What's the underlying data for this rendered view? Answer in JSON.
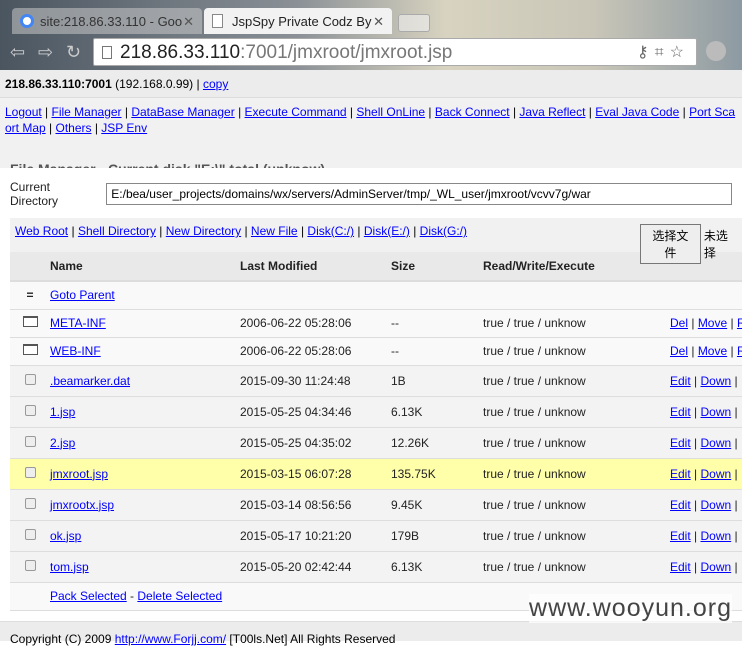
{
  "browser": {
    "tabs": [
      {
        "title": "site:218.86.33.110 - Goo"
      },
      {
        "title": "JspSpy Private Codz By"
      }
    ],
    "url_host": "218.86.33.110",
    "url_rest": ":7001/jmxroot/jmxroot.jsp"
  },
  "info": {
    "host": "218.86.33.110:7001",
    "ip": " (192.168.0.99) | ",
    "copy": "copy"
  },
  "menu": {
    "line1": [
      "Logout",
      "File Manager",
      "DataBase Manager",
      "Execute Command",
      "Shell OnLine",
      "Back Connect",
      "Java Reflect",
      "Eval Java Code",
      "Port Sca"
    ],
    "line2": [
      "ort Map",
      "Others",
      "JSP Env"
    ]
  },
  "title": "File Manager - Current disk \"E:\\\" total (unknow)",
  "current_dir": {
    "label": "Current Directory",
    "value": "E:/bea/user_projects/domains/wx/servers/AdminServer/tmp/_WL_user/jmxroot/vcvv7g/war"
  },
  "shortcuts": [
    "Web Root",
    "Shell Directory",
    "New Directory",
    "New File",
    "Disk(C:/)",
    "Disk(E:/)",
    "Disk(G:/)"
  ],
  "upload": {
    "button": "选择文件",
    "status": "未选择"
  },
  "table": {
    "headers": [
      "Name",
      "Last Modified",
      "Size",
      "Read/Write/Execute"
    ],
    "parent": "Goto Parent",
    "rows": [
      {
        "type": "folder",
        "name": "META-INF",
        "modified": "2006-06-22 05:28:06",
        "size": "--",
        "perm": "true / true / unknow",
        "actions": [
          "Del",
          "Move",
          "R"
        ]
      },
      {
        "type": "folder",
        "name": "WEB-INF",
        "modified": "2006-06-22 05:28:06",
        "size": "--",
        "perm": "true / true / unknow",
        "actions": [
          "Del",
          "Move",
          "R"
        ]
      },
      {
        "type": "file",
        "name": ".beamarker.dat",
        "modified": "2015-09-30 11:24:48",
        "size": "1B",
        "perm": "true / true / unknow",
        "actions": [
          "Edit",
          "Down"
        ]
      },
      {
        "type": "file",
        "name": "1.jsp",
        "modified": "2015-05-25 04:34:46",
        "size": "6.13K",
        "perm": "true / true / unknow",
        "actions": [
          "Edit",
          "Down"
        ]
      },
      {
        "type": "file",
        "name": "2.jsp",
        "modified": "2015-05-25 04:35:02",
        "size": "12.26K",
        "perm": "true / true / unknow",
        "actions": [
          "Edit",
          "Down"
        ]
      },
      {
        "type": "file",
        "name": "jmxroot.jsp",
        "modified": "2015-03-15 06:07:28",
        "size": "135.75K",
        "perm": "true / true / unknow",
        "actions": [
          "Edit",
          "Down"
        ],
        "highlight": true
      },
      {
        "type": "file",
        "name": "jmxrootx.jsp",
        "modified": "2015-03-14 08:56:56",
        "size": "9.45K",
        "perm": "true / true / unknow",
        "actions": [
          "Edit",
          "Down"
        ]
      },
      {
        "type": "file",
        "name": "ok.jsp",
        "modified": "2015-05-17 10:21:20",
        "size": "179B",
        "perm": "true / true / unknow",
        "actions": [
          "Edit",
          "Down"
        ]
      },
      {
        "type": "file",
        "name": "tom.jsp",
        "modified": "2015-05-20 02:42:44",
        "size": "6.13K",
        "perm": "true / true / unknow",
        "actions": [
          "Edit",
          "Down"
        ]
      }
    ],
    "pack": "Pack Selected",
    "delete": "Delete Selected"
  },
  "footer": {
    "pre": "Copyright (C) 2009 ",
    "link": "http://www.Forjj.com/",
    "mid": "  [T00ls.Net] All Rights Reserved"
  },
  "watermark": "www.wooyun.org"
}
